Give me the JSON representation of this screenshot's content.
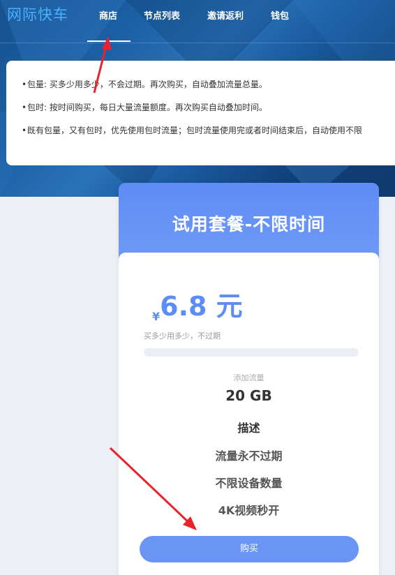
{
  "nav": {
    "brand": "网际快车",
    "items": [
      {
        "label": "商店",
        "active": true
      },
      {
        "label": "节点列表",
        "active": false
      },
      {
        "label": "邀请返利",
        "active": false
      },
      {
        "label": "钱包",
        "active": false
      }
    ]
  },
  "notice": {
    "lines": [
      "包量: 买多少用多少，不会过期。再次购买，自动叠加流量总量。",
      "包时: 按时间购买，每日大量流量额度。再次购买自动叠加时间。",
      "既有包量，又有包时，优先使用包时流量；包时流量使用完或者时间结束后，自动使用不限"
    ]
  },
  "plan": {
    "title": "试用套餐-不限时间",
    "currency_symbol": "¥",
    "price": "6.8 元",
    "price_desc": "买多少用多少，不过期",
    "progress": 0,
    "feature_label": "添加流量",
    "feature_value": "20 GB",
    "desc_heading": "描述",
    "features": [
      "流量永不过期",
      "不限设备数量",
      "4K视频秒开"
    ],
    "buy_label": "购买"
  },
  "colors": {
    "accent": "#6b95f5",
    "brand": "#49b2ff",
    "annotation_arrow": "#e8232a"
  }
}
